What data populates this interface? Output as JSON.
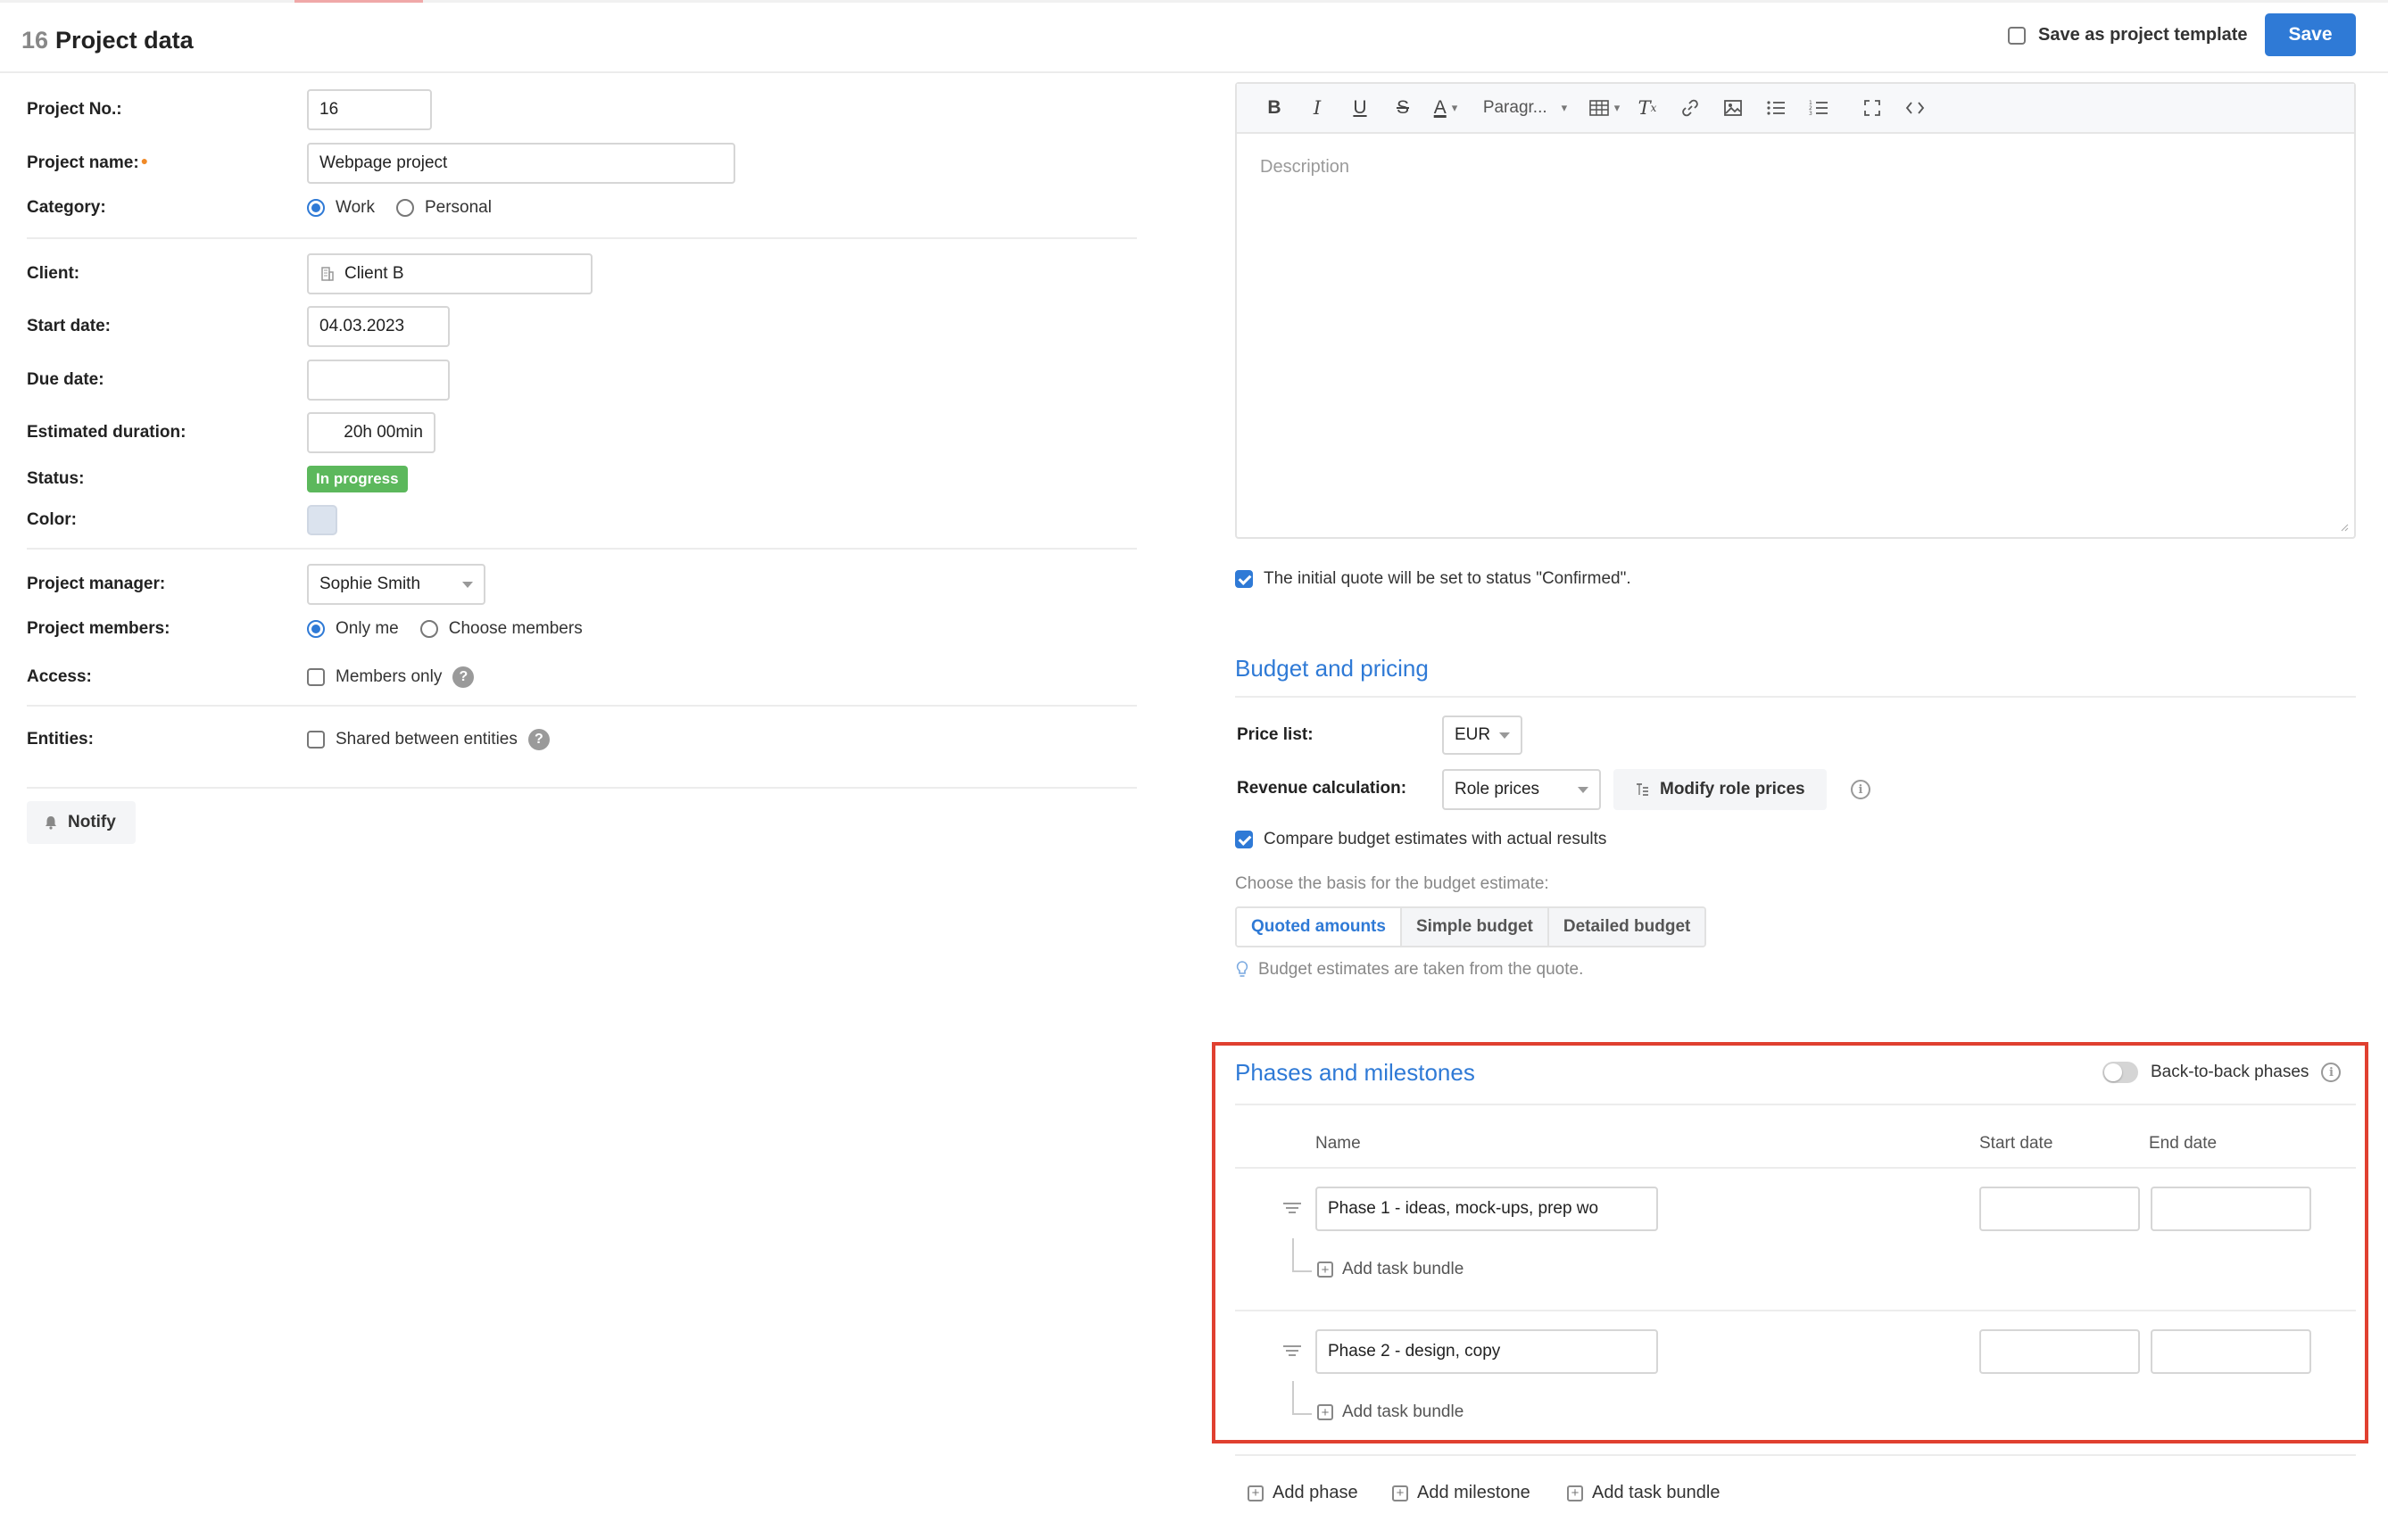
{
  "header": {
    "project_number": "16",
    "title": "Project data",
    "save_template_label": "Save as project template",
    "save_label": "Save"
  },
  "form": {
    "project_no_label": "Project No.:",
    "project_no_value": "16",
    "project_name_label": "Project name:",
    "project_name_value": "Webpage project",
    "category_label": "Category:",
    "category_options": [
      "Work",
      "Personal"
    ],
    "client_label": "Client:",
    "client_value": "Client B",
    "start_date_label": "Start date:",
    "start_date_value": "04.03.2023",
    "due_date_label": "Due date:",
    "due_date_value": "",
    "estimated_duration_label": "Estimated duration:",
    "estimated_duration_value": "20h 00min",
    "status_label": "Status:",
    "status_value": "In progress",
    "color_label": "Color:",
    "color_value": "#dbe3ee",
    "project_manager_label": "Project manager:",
    "project_manager_value": "Sophie Smith",
    "project_members_label": "Project members:",
    "project_members_options": [
      "Only me",
      "Choose members"
    ],
    "access_label": "Access:",
    "access_option": "Members only",
    "entities_label": "Entities:",
    "entities_option": "Shared between entities",
    "notify_label": "Notify"
  },
  "editor": {
    "paragraph_label": "Paragr...",
    "placeholder": "Description"
  },
  "confirm_text": "The initial quote will be set to status \"Confirmed\".",
  "budget": {
    "title": "Budget and pricing",
    "price_list_label": "Price list:",
    "price_list_value": "EUR",
    "revenue_label": "Revenue calculation:",
    "revenue_value": "Role prices",
    "modify_label": "Modify role prices",
    "compare_label": "Compare budget estimates with actual results",
    "basis_label": "Choose the basis for the budget estimate:",
    "basis_options": [
      "Quoted amounts",
      "Simple budget",
      "Detailed budget"
    ],
    "hint": "Budget estimates are taken from the quote."
  },
  "phases": {
    "title": "Phases and milestones",
    "back_to_back_label": "Back-to-back phases",
    "col_name": "Name",
    "col_start": "Start date",
    "col_end": "End date",
    "items": [
      {
        "name": "Phase 1 - ideas, mock-ups, prep wo",
        "add_label": "Add task bundle"
      },
      {
        "name": "Phase 2 - design, copy",
        "add_label": "Add task bundle"
      }
    ]
  },
  "bottom_actions": {
    "add_phase": "Add phase",
    "add_milestone": "Add milestone",
    "add_task_bundle": "Add task bundle"
  },
  "colors": {
    "accent": "#2f7ad6",
    "status_green": "#5cb85c",
    "highlight_red": "#e04030"
  }
}
